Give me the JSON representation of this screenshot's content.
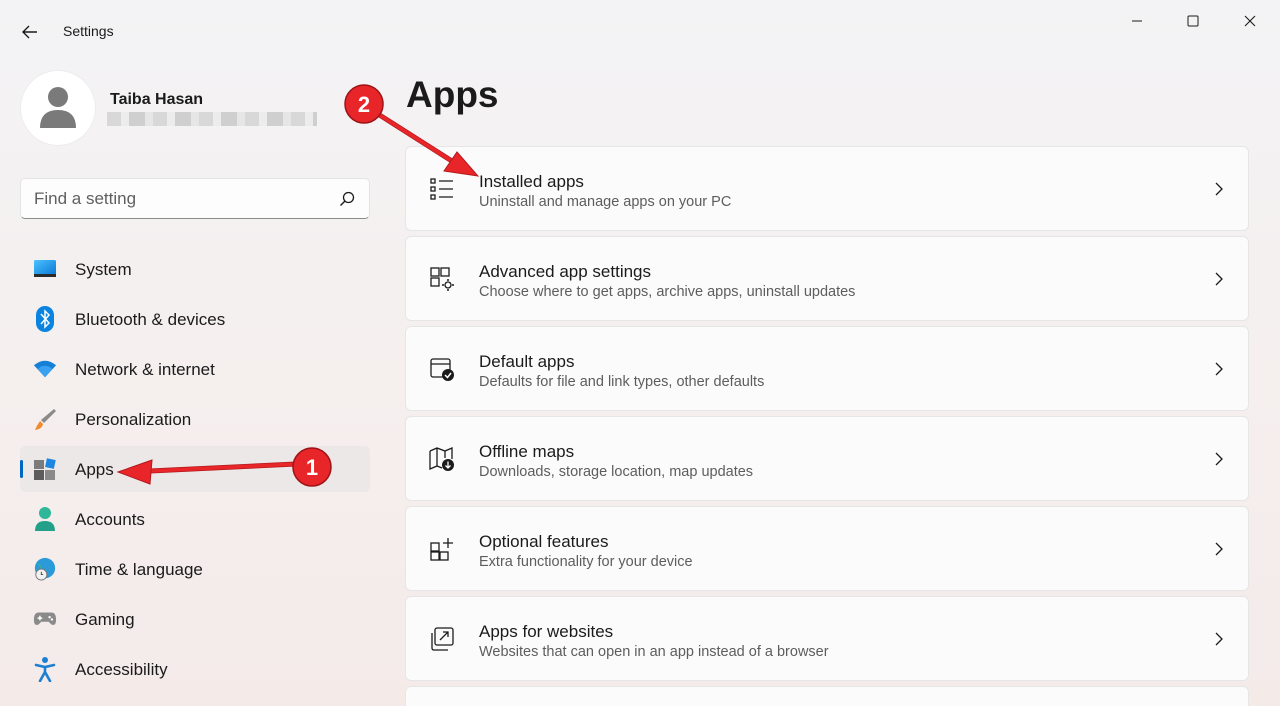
{
  "window": {
    "title": "Settings",
    "back_icon": "back-arrow-icon",
    "controls": [
      "minimize-icon",
      "maximize-icon",
      "close-icon"
    ]
  },
  "profile": {
    "name": "Taiba Hasan",
    "avatar_icon": "person-icon"
  },
  "search": {
    "placeholder": "Find a setting",
    "icon": "search-icon"
  },
  "sidebar": {
    "selected": "Apps",
    "accent": "#0067c0",
    "items": [
      {
        "label": "System",
        "icon": "system-icon"
      },
      {
        "label": "Bluetooth & devices",
        "icon": "bluetooth-icon"
      },
      {
        "label": "Network & internet",
        "icon": "wifi-icon"
      },
      {
        "label": "Personalization",
        "icon": "brush-icon"
      },
      {
        "label": "Apps",
        "icon": "apps-icon"
      },
      {
        "label": "Accounts",
        "icon": "accounts-icon"
      },
      {
        "label": "Time & language",
        "icon": "globe-clock-icon"
      },
      {
        "label": "Gaming",
        "icon": "gamepad-icon"
      },
      {
        "label": "Accessibility",
        "icon": "accessibility-icon"
      }
    ]
  },
  "main": {
    "title": "Apps",
    "cards": [
      {
        "title": "Installed apps",
        "subtitle": "Uninstall and manage apps on your PC",
        "icon": "list-icon"
      },
      {
        "title": "Advanced app settings",
        "subtitle": "Choose where to get apps, archive apps, uninstall updates",
        "icon": "app-settings-icon"
      },
      {
        "title": "Default apps",
        "subtitle": "Defaults for file and link types, other defaults",
        "icon": "default-apps-icon"
      },
      {
        "title": "Offline maps",
        "subtitle": "Downloads, storage location, map updates",
        "icon": "offline-map-icon"
      },
      {
        "title": "Optional features",
        "subtitle": "Extra functionality for your device",
        "icon": "add-feature-icon"
      },
      {
        "title": "Apps for websites",
        "subtitle": "Websites that can open in an app instead of a browser",
        "icon": "open-in-app-icon"
      }
    ]
  },
  "annotations": {
    "step1": "1",
    "step2": "2",
    "color": "#e8262a"
  }
}
